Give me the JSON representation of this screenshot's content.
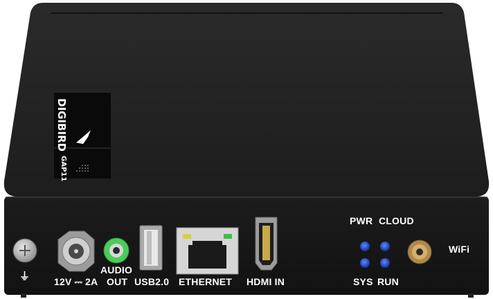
{
  "device": {
    "brand": "DIGIBIRD",
    "model": "GAP11",
    "colors": {
      "body": "#1b1b1b",
      "front": "#151515",
      "led": "#1d4fd8",
      "audio_jack": "#4ccc5a"
    }
  },
  "ports": {
    "ground_symbol": "⏚",
    "power_label": "12V ⎓ 2A",
    "audio_label_line1": "AUDIO",
    "audio_label_line2": "OUT",
    "usb_label": "USB2.0",
    "ethernet_label": "ETHERNET",
    "hdmi_label": "HDMI IN",
    "wifi_label": "WiFi"
  },
  "leds": {
    "top_left": "PWR",
    "top_right": "CLOUD",
    "bottom_left": "SYS",
    "bottom_right": "RUN"
  }
}
